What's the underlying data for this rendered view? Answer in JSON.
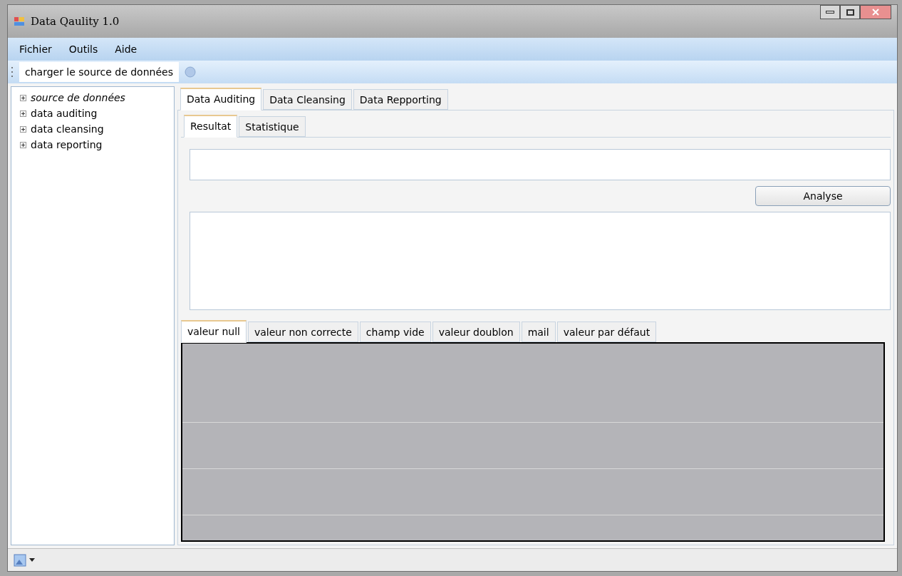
{
  "window": {
    "title": "Data Qaulity 1.0"
  },
  "menu": [
    "Fichier",
    "Outils",
    "Aide"
  ],
  "toolbar": {
    "button": "charger le source de données"
  },
  "tree": [
    {
      "label": "source de données",
      "expanded": false,
      "selected": true
    },
    {
      "label": "data auditing",
      "expanded": false,
      "selected": false
    },
    {
      "label": "data cleansing",
      "expanded": false,
      "selected": false
    },
    {
      "label": "data reporting",
      "expanded": false,
      "selected": false
    }
  ],
  "main_tabs": [
    {
      "label": "Data Auditing",
      "selected": true
    },
    {
      "label": "Data Cleansing",
      "selected": false
    },
    {
      "label": "Data Repporting",
      "selected": false
    }
  ],
  "sub_tabs": [
    {
      "label": "Resultat",
      "selected": true
    },
    {
      "label": "Statistique",
      "selected": false
    }
  ],
  "analyse_button": "Analyse",
  "result_tabs": [
    {
      "label": "valeur null",
      "selected": true
    },
    {
      "label": "valeur non correcte",
      "selected": false
    },
    {
      "label": "champ vide",
      "selected": false
    },
    {
      "label": "valeur doublon",
      "selected": false
    },
    {
      "label": "mail",
      "selected": false
    },
    {
      "label": "valeur par défaut",
      "selected": false
    }
  ]
}
